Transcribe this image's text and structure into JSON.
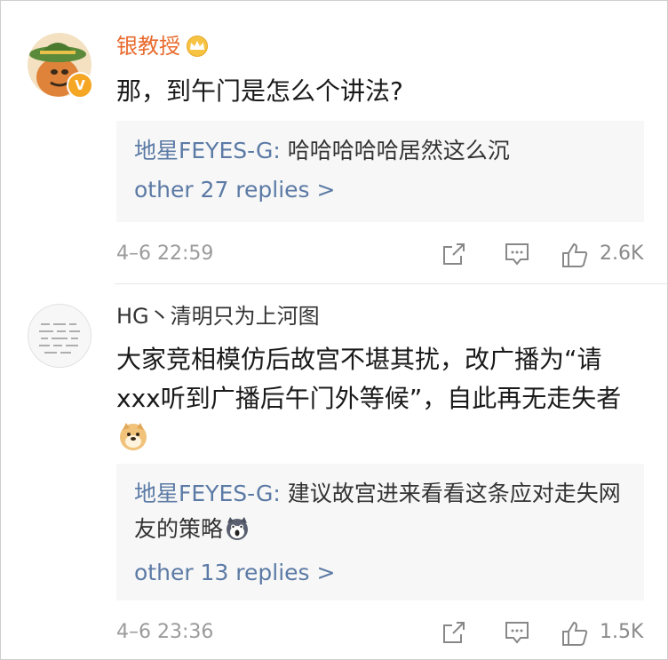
{
  "comments": [
    {
      "username": "银教授",
      "has_crown": true,
      "verified_badge": "V",
      "text": "那，到午门是怎么个讲法?",
      "reply": {
        "author": "地星FEYES-G:",
        "text": " 哈哈哈哈哈居然这么沉",
        "more": "other 27 replies >"
      },
      "time": "4–6 22:59",
      "likes": "2.6K"
    },
    {
      "username": "HG丶清明只为上河图",
      "text": "大家竞相模仿后故宫不堪其扰，改广播为“请xxx听到广播后午门外等候”，自此再无走失者",
      "emoji": "doge-emoji",
      "reply": {
        "author": "地星FEYES-G:",
        "text": " 建议故宫进来看看这条应对走失网友的策略",
        "emoji": "husky-emoji",
        "more": "other 13 replies >"
      },
      "time": "4–6 23:36",
      "likes": "1.5K"
    }
  ],
  "colors": {
    "username_highlight": "#e86a2d",
    "link": "#5b7aa5",
    "meta": "#9b9b9b"
  }
}
